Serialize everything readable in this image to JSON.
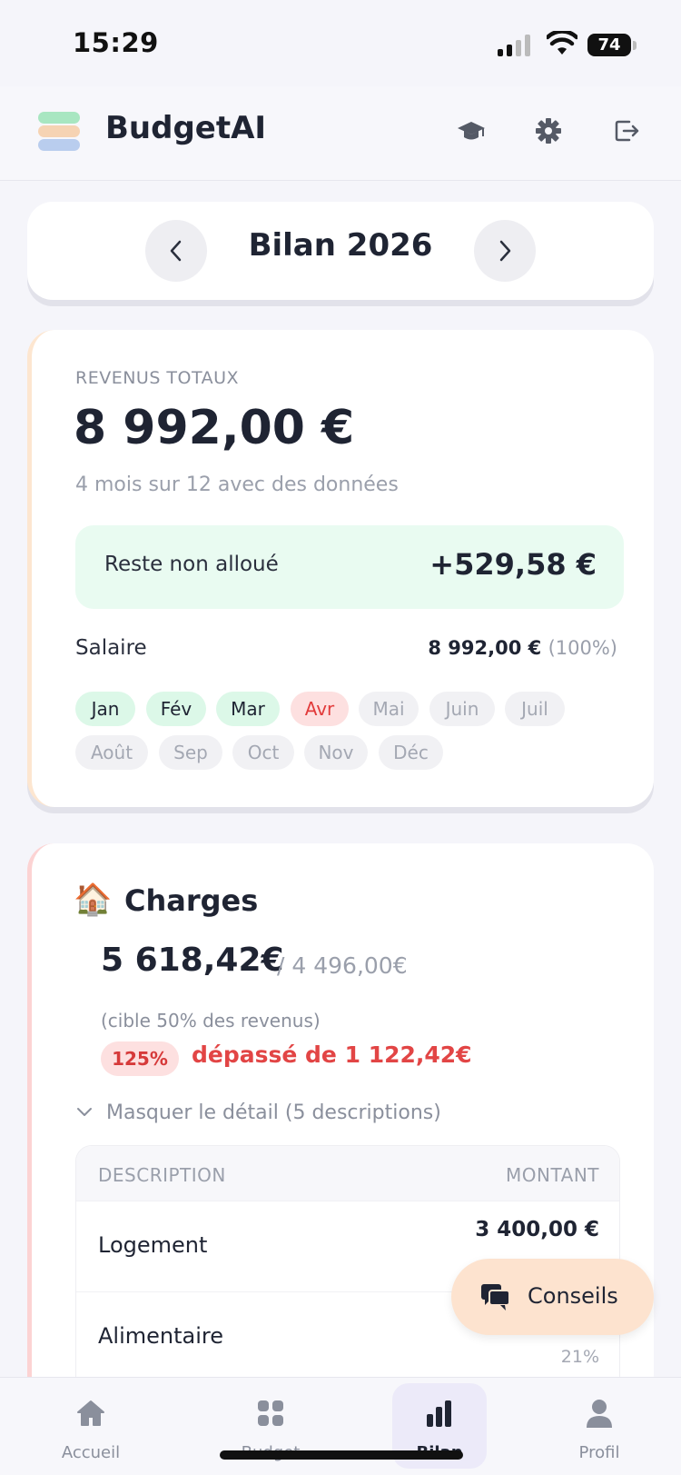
{
  "status_bar": {
    "time": "15:29",
    "battery": "74"
  },
  "header": {
    "app_title": "BudgetAI"
  },
  "year_nav": {
    "title": "Bilan 2026"
  },
  "revenue": {
    "label": "REVENUS TOTAUX",
    "amount": "8 992,00 €",
    "subtitle": "4 mois sur 12 avec des données",
    "reste_label": "Reste non alloué",
    "reste_value": "+529,58 €",
    "source_label": "Salaire",
    "source_value": "8 992,00 €",
    "source_pct": "(100%)",
    "months": [
      {
        "label": "Jan",
        "status": "green"
      },
      {
        "label": "Fév",
        "status": "green"
      },
      {
        "label": "Mar",
        "status": "green"
      },
      {
        "label": "Avr",
        "status": "red"
      },
      {
        "label": "Mai",
        "status": "grey"
      },
      {
        "label": "Juin",
        "status": "grey"
      },
      {
        "label": "Juil",
        "status": "grey"
      },
      {
        "label": "Août",
        "status": "grey"
      },
      {
        "label": "Sep",
        "status": "grey"
      },
      {
        "label": "Oct",
        "status": "grey"
      },
      {
        "label": "Nov",
        "status": "grey"
      },
      {
        "label": "Déc",
        "status": "grey"
      }
    ]
  },
  "charges": {
    "emoji": "🏠",
    "title": "Charges",
    "amount": "5 618,42€",
    "target": "4 496,00€",
    "target_note": "(cible 50% des revenus)",
    "pct_badge": "125%",
    "overrun": "dépassé de 1 122,42€",
    "toggle_label": "Masquer le détail (5 descriptions)",
    "table": {
      "col_desc": "DESCRIPTION",
      "col_amount": "MONTANT",
      "rows": [
        {
          "description": "Logement",
          "amount": "3 400,00 €",
          "pct": ""
        },
        {
          "description": "Alimentaire",
          "amount": "",
          "pct": "21%"
        }
      ]
    }
  },
  "fab": {
    "label": "Conseils"
  },
  "tabs": [
    {
      "label": "Accueil",
      "icon": "home-icon"
    },
    {
      "label": "Budget",
      "icon": "grid-icon"
    },
    {
      "label": "Bilan",
      "icon": "bar-chart-icon"
    },
    {
      "label": "Profil",
      "icon": "person-icon"
    }
  ],
  "colors": {
    "accent": "#1f2433",
    "positive_bg": "#e9fbf1",
    "negative": "#e24545",
    "fab_bg": "#fde3cf",
    "active_tab_bg": "#eceaf9"
  }
}
